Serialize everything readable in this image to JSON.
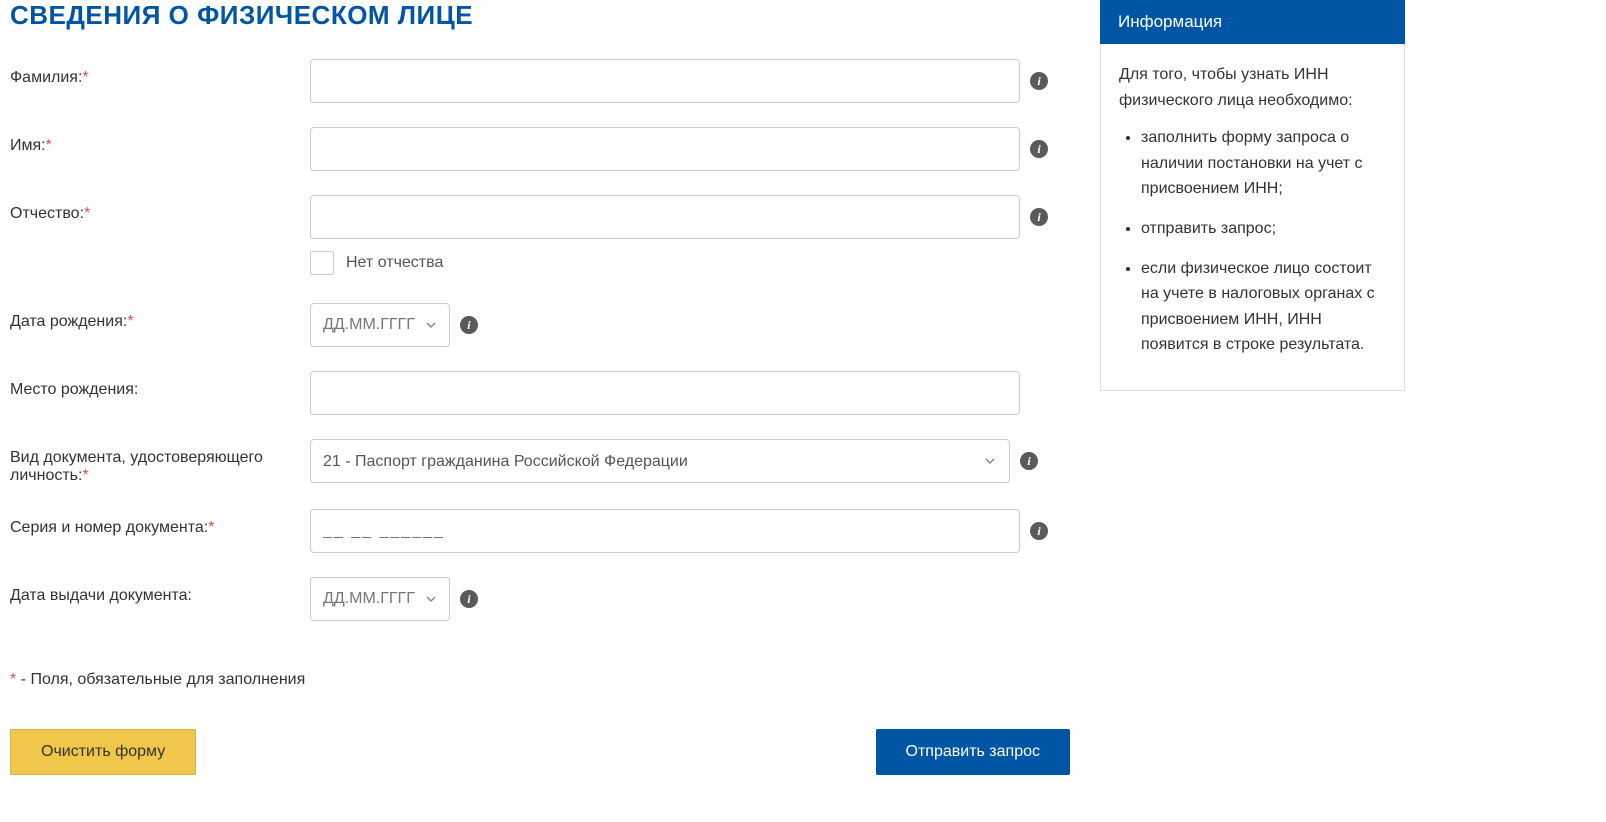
{
  "pageTitle": "СВЕДЕНИЯ О ФИЗИЧЕСКОМ ЛИЦЕ",
  "labels": {
    "surname": "Фамилия:",
    "name": "Имя:",
    "patronymic": "Отчество:",
    "noPatronymic": "Нет отчества",
    "birthDate": "Дата рождения:",
    "birthPlace": "Место рождения:",
    "docType": "Вид документа, удостоверяющего личность:",
    "docSerial": "Серия и номер документа:",
    "docIssueDate": "Дата выдачи документа:"
  },
  "placeholders": {
    "date": "ДД.ММ.ГГГГ",
    "serial": "__ __ ______"
  },
  "docTypeSelected": "21 - Паспорт гражданина Российской Федерации",
  "note": {
    "asterisk": "*",
    "text": " - Поля, обязательные для заполнения"
  },
  "buttons": {
    "clear": "Очистить форму",
    "submit": "Отправить запрос"
  },
  "sidebar": {
    "header": "Информация",
    "intro": "Для того, чтобы узнать ИНН физического лица необходимо:",
    "items": [
      "заполнить форму запроса о наличии постановки на учет с присвоением ИНН;",
      "отправить запрос;",
      "если физическое лицо состоит на учете в налоговых органах с присвоением ИНН, ИНН появится в строке результата."
    ]
  }
}
